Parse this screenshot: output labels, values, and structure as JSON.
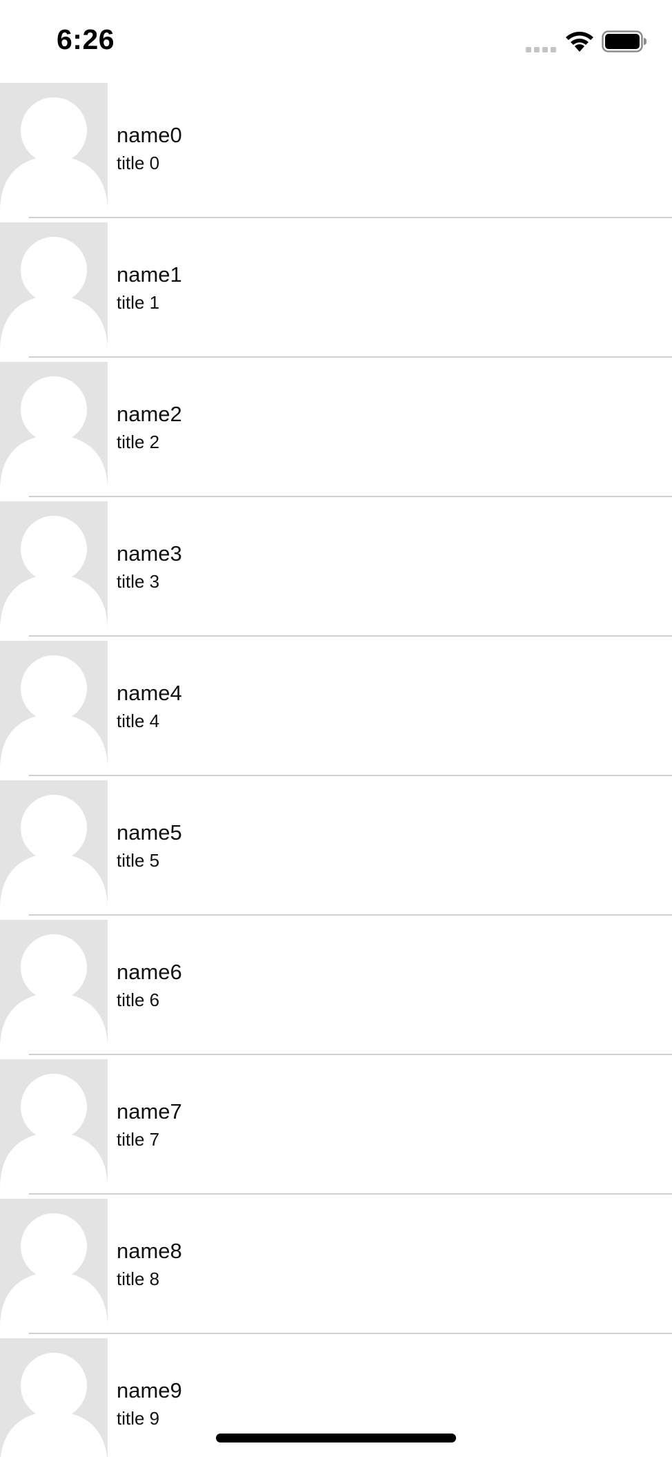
{
  "status_bar": {
    "time": "6:26",
    "icons": [
      "signal-icon",
      "wifi-icon",
      "battery-icon"
    ]
  },
  "contacts": [
    {
      "name": "name0",
      "title": "title 0"
    },
    {
      "name": "name1",
      "title": "title 1"
    },
    {
      "name": "name2",
      "title": "title 2"
    },
    {
      "name": "name3",
      "title": "title 3"
    },
    {
      "name": "name4",
      "title": "title 4"
    },
    {
      "name": "name5",
      "title": "title 5"
    },
    {
      "name": "name6",
      "title": "title 6"
    },
    {
      "name": "name7",
      "title": "title 7"
    },
    {
      "name": "name8",
      "title": "title 8"
    },
    {
      "name": "name9",
      "title": "title 9"
    }
  ],
  "colors": {
    "avatar_background": "#e3e3e3",
    "avatar_silhouette": "#ffffff",
    "separator": "#cfcfd2",
    "text": "#111111"
  }
}
